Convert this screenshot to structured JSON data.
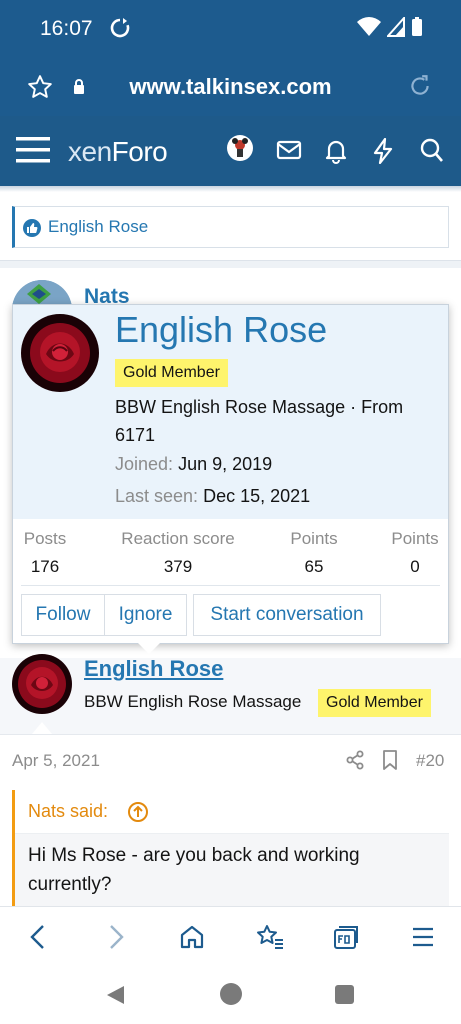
{
  "status_bar": {
    "time": "16:07"
  },
  "browser": {
    "url": "www.talkinsex.com"
  },
  "forum": {
    "logo_xen": "xen",
    "logo_foro": "Foro"
  },
  "like_bar": {
    "name": "English Rose"
  },
  "prev_post": {
    "author": "Nats"
  },
  "profile_popup": {
    "name": "English Rose",
    "badge": "Gold Member",
    "user_title": "BBW English Rose Massage · From 6171",
    "joined_label": "Joined:",
    "joined_value": "Jun 9, 2019",
    "last_seen_label": "Last seen:",
    "last_seen_value": "Dec 15, 2021",
    "stats": [
      {
        "label": "Posts",
        "value": "176"
      },
      {
        "label": "Reaction score",
        "value": "379"
      },
      {
        "label": "Points",
        "value": "65"
      },
      {
        "label": "Points",
        "value": "0"
      }
    ],
    "buttons": {
      "follow": "Follow",
      "ignore": "Ignore",
      "start_conversation": "Start conversation"
    }
  },
  "post": {
    "author": "English Rose",
    "user_title": "BBW English Rose Massage",
    "badge": "Gold Member",
    "date": "Apr 5, 2021",
    "number": "#20",
    "quote_author": "Nats said:",
    "quote_text": "Hi Ms Rose - are you back and working currently?"
  },
  "colors": {
    "header": "#1d5b8e",
    "link": "#2577b1",
    "badge": "#fef46c",
    "quote_accent": "#f39c12"
  }
}
